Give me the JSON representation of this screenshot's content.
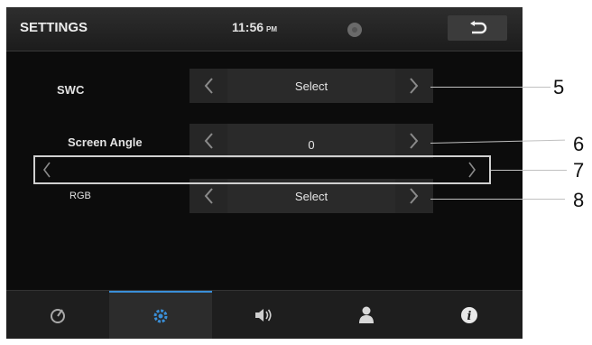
{
  "header": {
    "title": "SETTINGS",
    "time": "11:56",
    "ampm": "PM"
  },
  "rows": [
    {
      "label": "SWC",
      "value": "Select"
    },
    {
      "label": "Screen Angle",
      "value": "0"
    },
    {
      "label": "RGB",
      "value": "Select"
    }
  ],
  "callouts": [
    "5",
    "6",
    "7",
    "8"
  ],
  "tabs": [
    {
      "icon": "gauge-icon"
    },
    {
      "icon": "gear-icon"
    },
    {
      "icon": "speaker-icon"
    },
    {
      "icon": "user-icon"
    },
    {
      "icon": "info-icon"
    }
  ],
  "colors": {
    "active_tab": "#3a8fd8",
    "background": "#0c0c0c"
  }
}
